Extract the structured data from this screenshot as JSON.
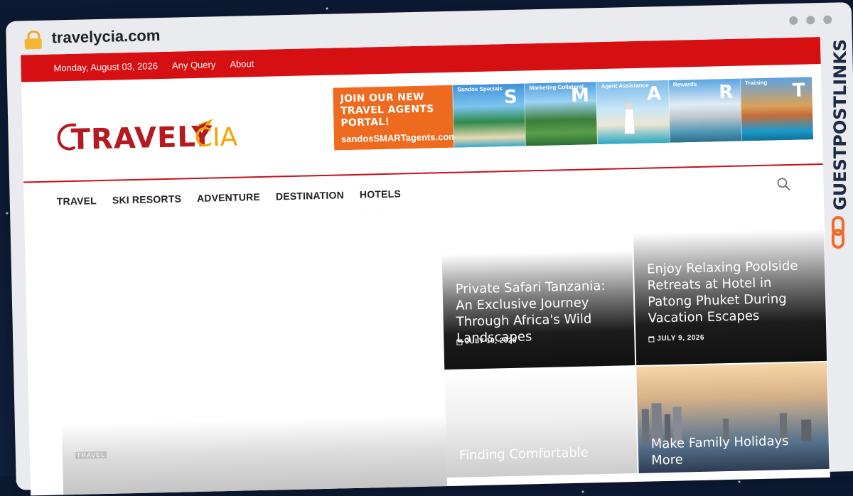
{
  "browser": {
    "url": "travelycia.com"
  },
  "topbar": {
    "date": "Monday, August 03, 2026",
    "links": [
      "Any Query",
      "About"
    ]
  },
  "logo": {
    "text_main": "TRAVELY",
    "text_suffix": "CIA"
  },
  "banner": {
    "headline": "JOIN OUR NEW TRAVEL AGENTS PORTAL!",
    "site": "sandosSMARTagents.com",
    "panels": [
      {
        "label": "Sandos Specials",
        "letter": "S"
      },
      {
        "label": "Marketing Collateral",
        "letter": "M"
      },
      {
        "label": "Agent Assistance",
        "letter": "A"
      },
      {
        "label": "Rewards",
        "letter": "R"
      },
      {
        "label": "Training",
        "letter": "T"
      }
    ]
  },
  "nav": {
    "items": [
      "TRAVEL",
      "SKI RESORTS",
      "ADVENTURE",
      "DESTINATION",
      "HOTELS"
    ]
  },
  "cards": {
    "big": {
      "category": "TRAVEL"
    },
    "c1": {
      "title": "Private Safari Tanzania: An Exclusive Journey Through Africa's Wild Landscapes",
      "date": "JULY 10, 2026"
    },
    "c2": {
      "title": "Enjoy Relaxing Poolside Retreats at Hotel in Patong Phuket During Vacation Escapes",
      "date": "JULY 9, 2026"
    },
    "c3": {
      "title": "Finding Comfortable"
    },
    "c4": {
      "title": "Make Family Holidays More"
    }
  },
  "watermark": {
    "text": "GUESTPOSTLINKS"
  },
  "colors": {
    "brand_red": "#d50f12",
    "logo_red": "#b51a20",
    "logo_yellow": "#f2a400",
    "banner_orange": "#ee6a1e"
  }
}
